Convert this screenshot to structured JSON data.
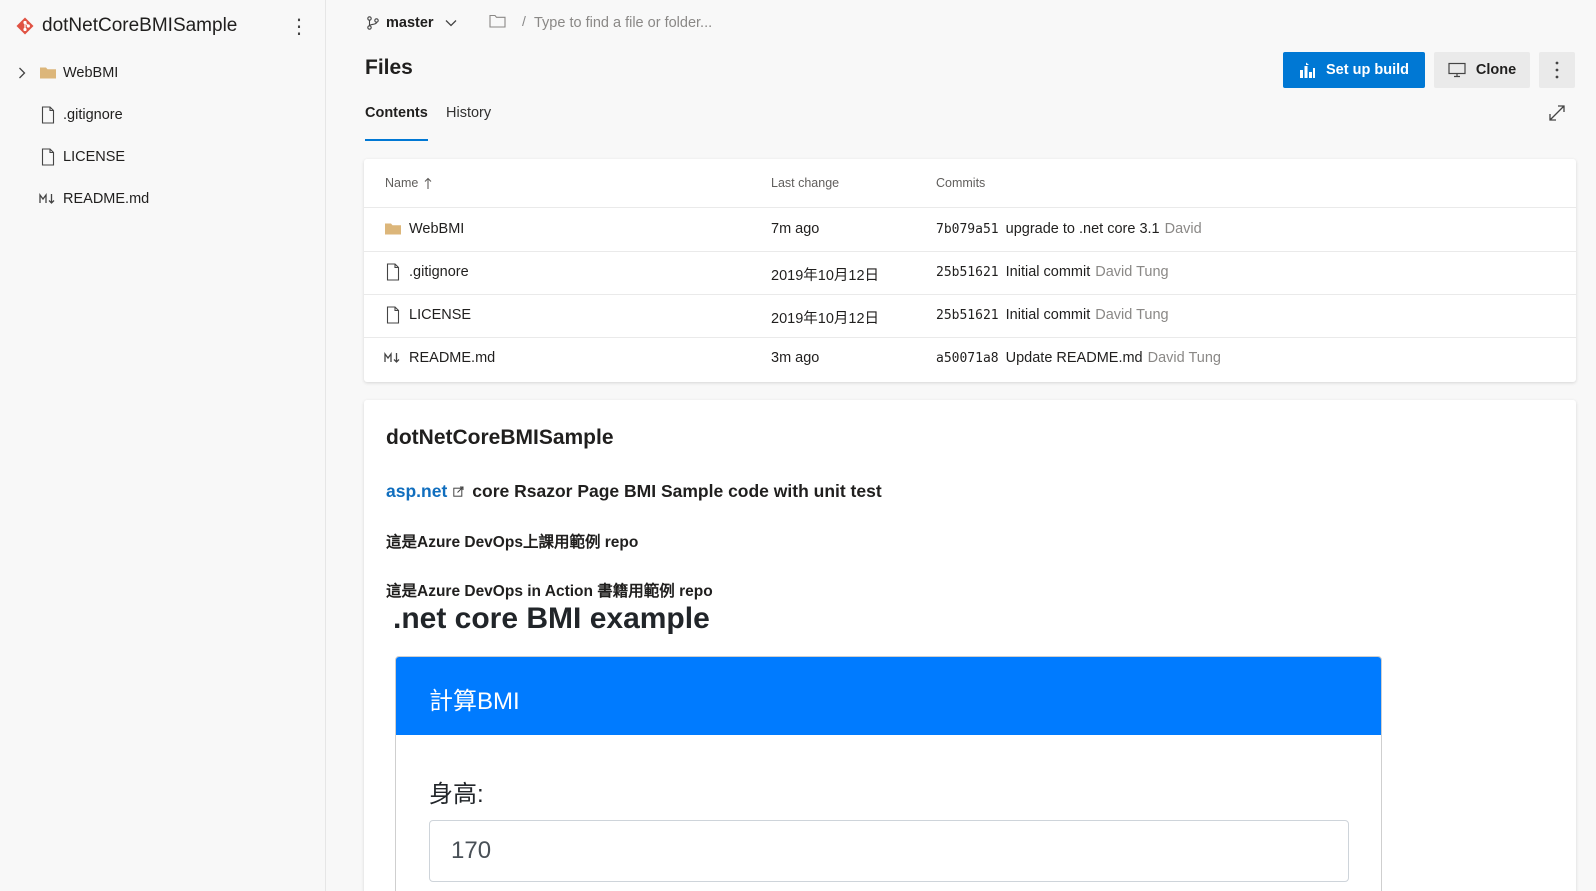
{
  "sidebar": {
    "repo_name": "dotNetCoreBMISample",
    "items": [
      {
        "label": "WebBMI",
        "type": "folder",
        "expandable": true
      },
      {
        "label": ".gitignore",
        "type": "file"
      },
      {
        "label": "LICENSE",
        "type": "file"
      },
      {
        "label": "README.md",
        "type": "markdown"
      }
    ]
  },
  "topbar": {
    "branch": "master",
    "path_separator": "/",
    "search_placeholder": "Type to find a file or folder..."
  },
  "header": {
    "title": "Files",
    "setup_build_label": "Set up build",
    "clone_label": "Clone"
  },
  "tabs": [
    {
      "label": "Contents",
      "active": true
    },
    {
      "label": "History",
      "active": false
    }
  ],
  "files_table": {
    "columns": [
      "Name",
      "Last change",
      "Commits"
    ],
    "rows": [
      {
        "name": "WebBMI",
        "type": "folder",
        "last_change": "7m ago",
        "commit_hash": "7b079a51",
        "commit_message": "upgrade to .net core 3.1",
        "commit_author": "David"
      },
      {
        "name": ".gitignore",
        "type": "file",
        "last_change": "2019年10月12日",
        "commit_hash": "25b51621",
        "commit_message": "Initial commit",
        "commit_author": "David Tung"
      },
      {
        "name": "LICENSE",
        "type": "file",
        "last_change": "2019年10月12日",
        "commit_hash": "25b51621",
        "commit_message": "Initial commit",
        "commit_author": "David Tung"
      },
      {
        "name": "README.md",
        "type": "markdown",
        "last_change": "3m ago",
        "commit_hash": "a50071a8",
        "commit_message": "Update README.md",
        "commit_author": "David Tung"
      }
    ]
  },
  "readme": {
    "title": "dotNetCoreBMISample",
    "line1_link": "asp.net",
    "line1_rest": "core Rsazor Page BMI Sample code with unit test",
    "para2": "這是Azure DevOps上課用範例 repo",
    "para3": "這是Azure DevOps in Action 書籍用範例 repo",
    "h1": ".net core BMI example",
    "card_header": "計算BMI",
    "height_label": "身高:",
    "height_value": "170"
  },
  "colors": {
    "accent": "#0078d4",
    "bootstrap_primary": "#007bff",
    "folder": "#dcb67a",
    "repo_logo": "#e05243"
  }
}
